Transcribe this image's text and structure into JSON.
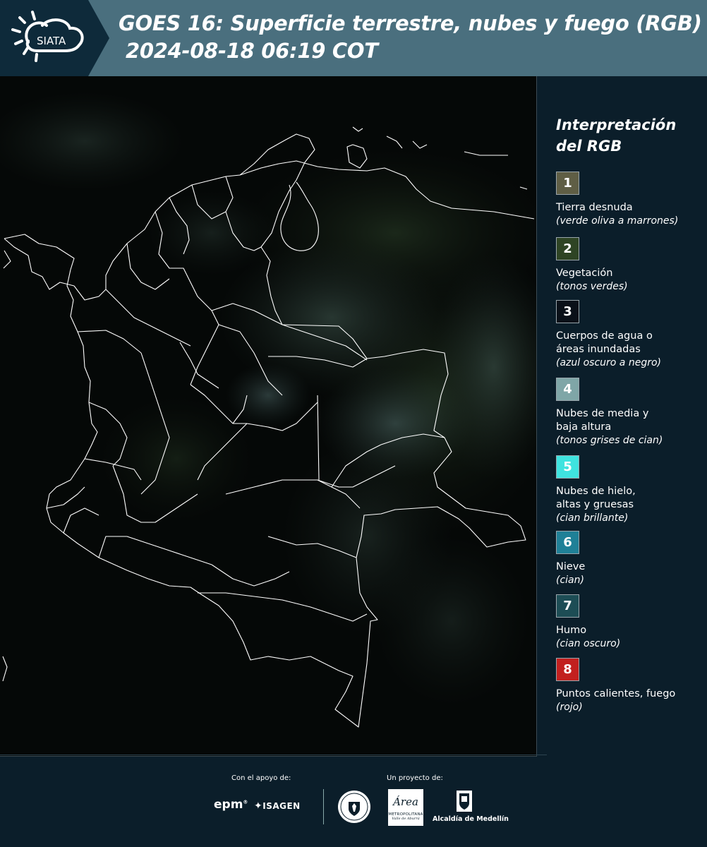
{
  "header": {
    "brand": "SIATA",
    "title_line1": "GOES 16: Superficie terrestre, nubes y fuego (RGB)",
    "title_line2": "2024-08-18 06:19 COT",
    "bg_color": "#4a6f7e"
  },
  "map": {
    "product": "RGB composite, night-time dark scene",
    "outline_color": "#ffffff"
  },
  "legend": {
    "title_line1": "Interpretación",
    "title_line2": "del RGB",
    "items": [
      {
        "number": "1",
        "color": "#5f5e45",
        "label_lines": [
          "Tierra desnuda"
        ],
        "desc": "(verde oliva a marrones)"
      },
      {
        "number": "2",
        "color": "#2e4424",
        "label_lines": [
          "Vegetación"
        ],
        "desc": "(tonos verdes)"
      },
      {
        "number": "3",
        "color": "#0a1018",
        "label_lines": [
          "Cuerpos de agua o",
          "áreas inundadas"
        ],
        "desc": "(azul oscuro a negro)"
      },
      {
        "number": "4",
        "color": "#7fa6a7",
        "label_lines": [
          "Nubes de media y",
          "baja altura"
        ],
        "desc": "(tonos grises de cian)"
      },
      {
        "number": "5",
        "color": "#3fe3df",
        "label_lines": [
          "Nubes de hielo,",
          "altas y gruesas"
        ],
        "desc": "(cian brillante)"
      },
      {
        "number": "6",
        "color": "#1f8097",
        "label_lines": [
          "Nieve"
        ],
        "desc": "(cian)"
      },
      {
        "number": "7",
        "color": "#1d4d55",
        "label_lines": [
          "Humo"
        ],
        "desc": "(cian oscuro)"
      },
      {
        "number": "8",
        "color": "#c2201f",
        "label_lines": [
          "Puntos calientes, fuego"
        ],
        "desc": "(rojo)"
      }
    ]
  },
  "footer": {
    "support_caption": "Con el apoyo de:",
    "project_caption": "Un proyecto de:",
    "sponsors": [
      "epm",
      "ISAGEN"
    ],
    "partners": {
      "area_script": "Área",
      "area_line1": "METROPOLITANA",
      "area_line2": "Valle de Aburrá",
      "alcaldia": "Alcaldía de Medellín"
    }
  }
}
